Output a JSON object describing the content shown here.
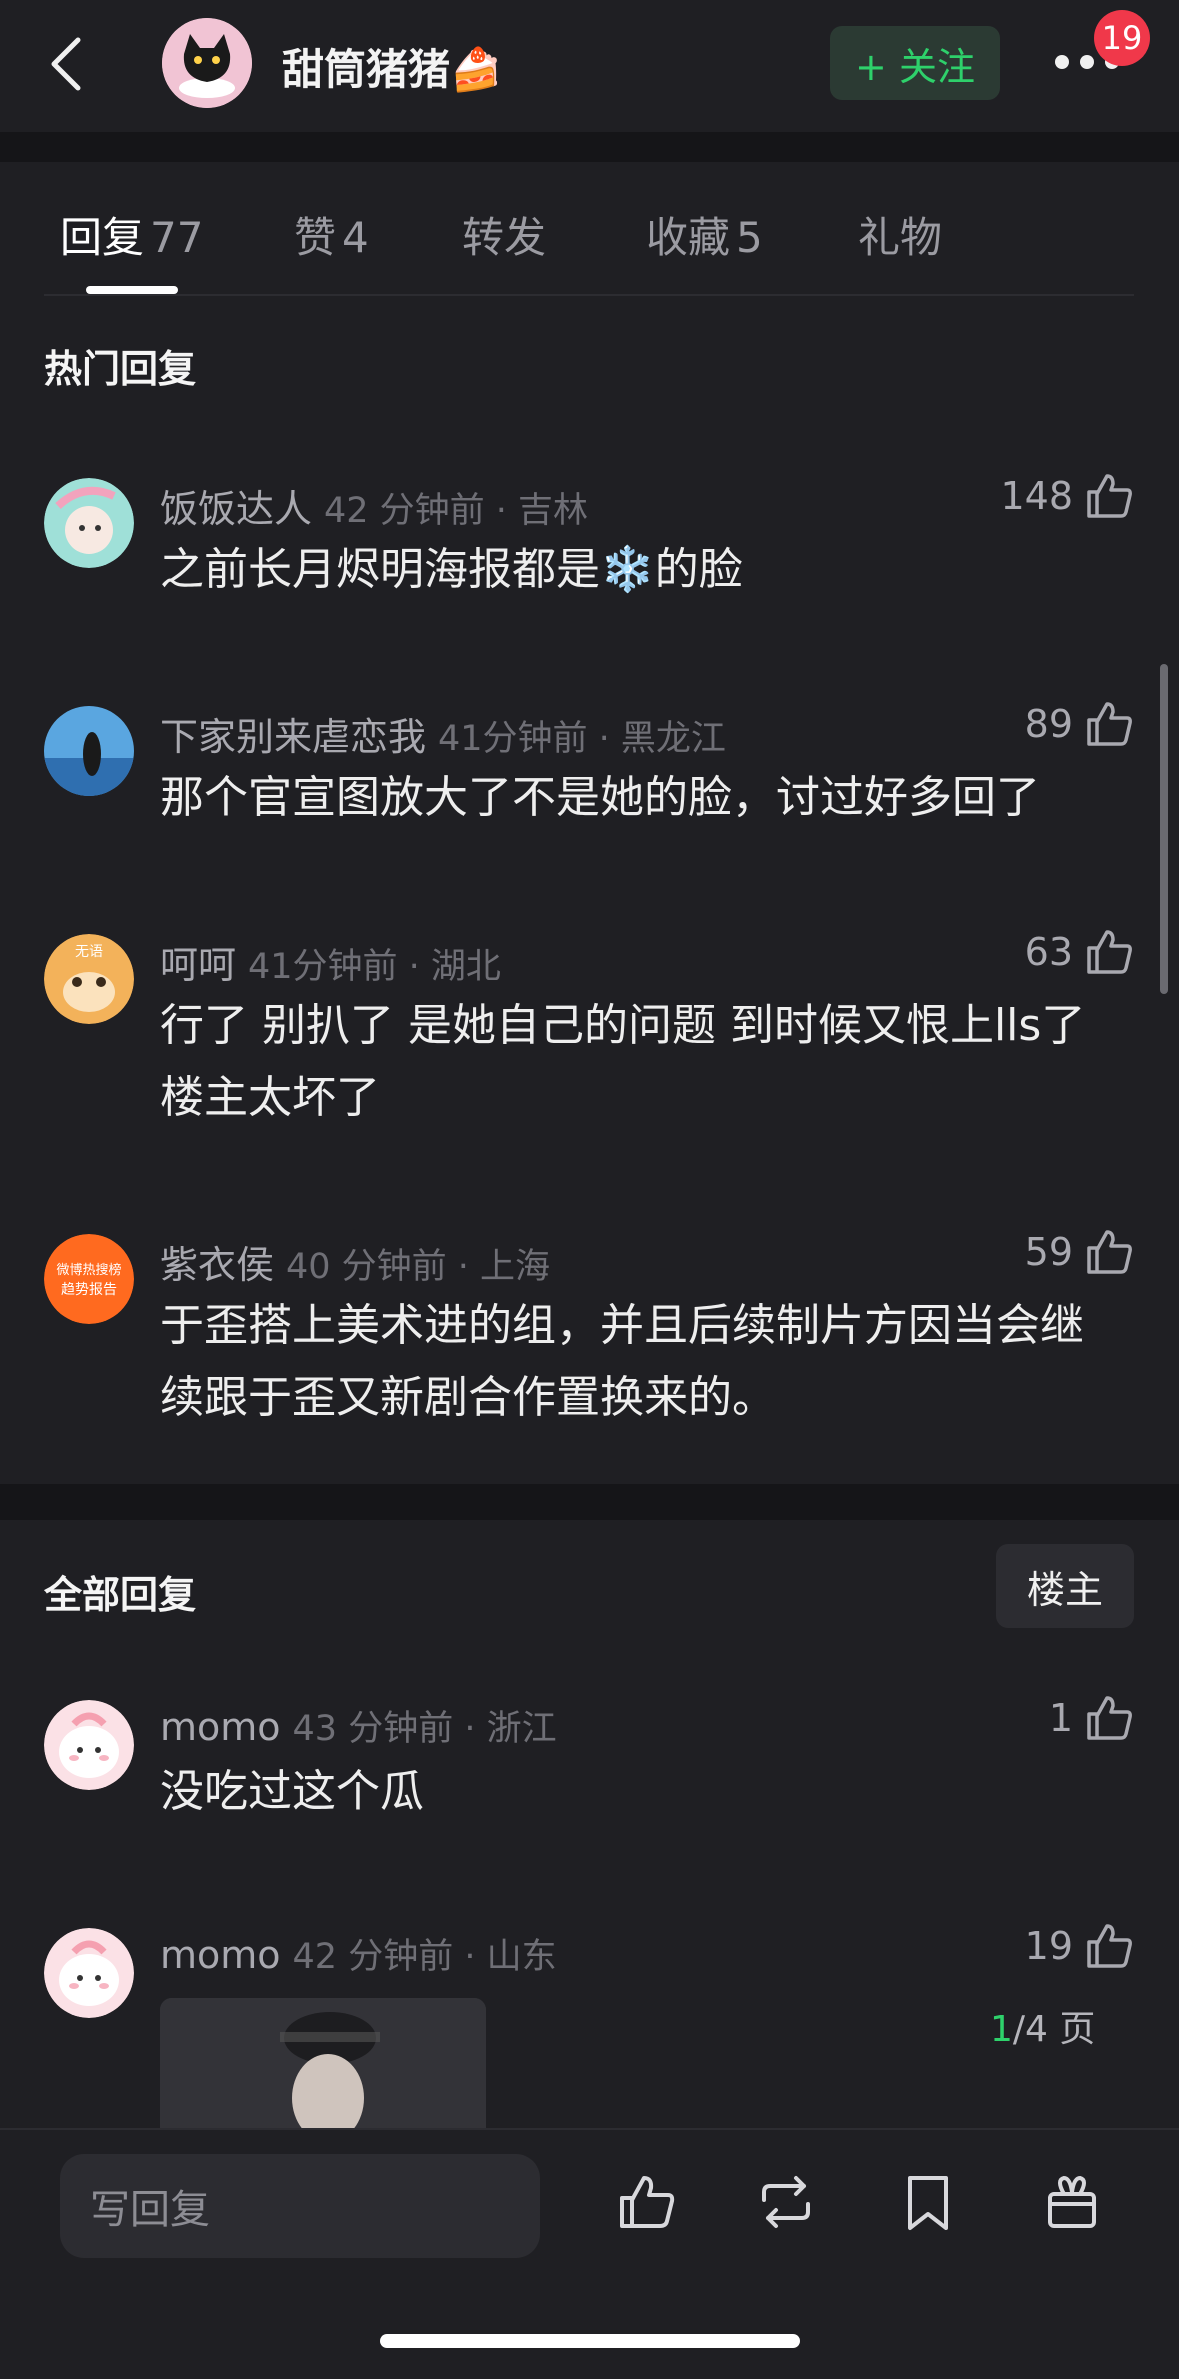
{
  "header": {
    "username": "甜筒猪猪🍰",
    "follow_label": "+ 关注",
    "notification_count": "19"
  },
  "tabs": [
    {
      "label": "回复",
      "count": "77"
    },
    {
      "label": "赞",
      "count": "4"
    },
    {
      "label": "转发",
      "count": ""
    },
    {
      "label": "收藏",
      "count": "5"
    },
    {
      "label": "礼物",
      "count": ""
    }
  ],
  "hot_section": {
    "title": "热门回复",
    "comments": [
      {
        "name": "饭饭达人",
        "time": "42 分钟前 · 吉林",
        "likes": "148",
        "text": "之前长月烬明海报都是❄️的脸"
      },
      {
        "name": "下家别来虐恋我",
        "time": "41分钟前 · 黑龙江",
        "likes": "89",
        "text": "那个官宣图放大了不是她的脸，讨过好多回了"
      },
      {
        "name": "呵呵",
        "time": "41分钟前 · 湖北",
        "likes": "63",
        "text": "行了 别扒了 是她自己的问题 到时候又恨上lls了 楼主太坏了"
      },
      {
        "name": "紫衣侯",
        "time": "40 分钟前 · 上海",
        "likes": "59",
        "text": "于歪搭上美术进的组，并且后续制片方因当会继续跟于歪又新剧合作置换来的。"
      }
    ]
  },
  "all_section": {
    "title": "全部回复",
    "owner_filter": "楼主",
    "comments": [
      {
        "name": "momo",
        "time": "43 分钟前 · 浙江",
        "likes": "1",
        "text": "没吃过这个瓜"
      },
      {
        "name": "momo",
        "time": "42 分钟前 · 山东",
        "likes": "19",
        "text": ""
      }
    ]
  },
  "avatar_text": {
    "c3": "无语",
    "c4_line1": "微博热搜榜",
    "c4_line2": "趋势报告"
  },
  "page_indicator": {
    "current": "1",
    "total": "/4 页"
  },
  "bottom_bar": {
    "reply_placeholder": "写回复"
  },
  "colors": {
    "accent_green": "#2ed16b",
    "badge_red": "#f0384a",
    "background": "#1f1f23"
  }
}
